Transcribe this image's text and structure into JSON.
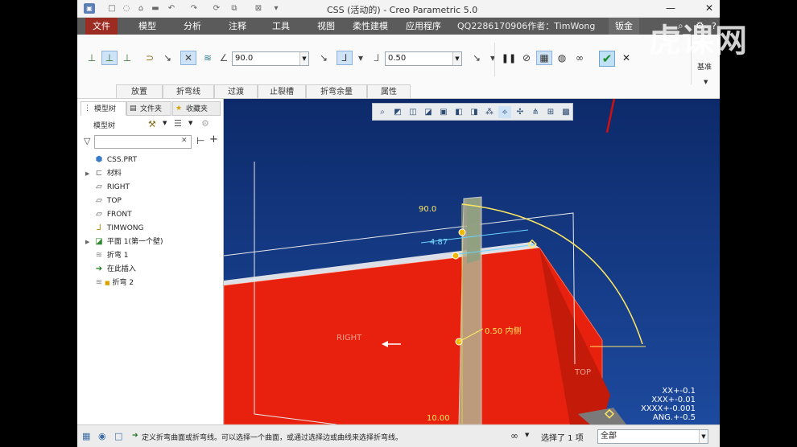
{
  "window": {
    "title": "CSS (活动的) - Creo Parametric 5.0",
    "minimize": "—",
    "close": "✕"
  },
  "menubar": {
    "items": [
      "文件",
      "模型",
      "分析",
      "注释",
      "工具",
      "视图",
      "柔性建模",
      "应用程序"
    ],
    "author": "QQ2286170906作者：TimWong",
    "last": "钣金"
  },
  "ribbon": {
    "angle_value": "90.0",
    "radius_value": "0.50",
    "tabs": [
      "放置",
      "折弯线",
      "过渡",
      "止裂槽",
      "折弯余量",
      "属性"
    ],
    "datum_label": "基准"
  },
  "sidebar": {
    "tabs": [
      "模型树",
      "文件夹",
      "收藏夹"
    ],
    "header": "模型树",
    "search_placeholder": "",
    "tree": [
      {
        "label": "CSS.PRT",
        "icon": "part-icon"
      },
      {
        "label": "材料",
        "icon": "material-icon"
      },
      {
        "label": "RIGHT",
        "icon": "plane-icon"
      },
      {
        "label": "TOP",
        "icon": "plane-icon"
      },
      {
        "label": "FRONT",
        "icon": "plane-icon"
      },
      {
        "label": "TIMWONG",
        "icon": "csys-icon"
      },
      {
        "label": "平面 1(第一个壁)",
        "icon": "wall-icon"
      },
      {
        "label": "折弯 1",
        "icon": "bend-icon"
      },
      {
        "label": "在此插入",
        "icon": "insert-arrow-icon"
      },
      {
        "label": "折弯 2",
        "icon": "bend-icon"
      }
    ]
  },
  "viewport": {
    "annotations": {
      "angle": "90.0",
      "offset": "4.87",
      "radius": "0.50 内侧",
      "length": "10.00",
      "right_plane": "RIGHT",
      "top_plane": "TOP"
    },
    "tolerances": [
      "XX+-0.1",
      "XXX+-0.01",
      "XXXX+-0.001",
      "ANG.+-0.5"
    ]
  },
  "statusbar": {
    "message": "定义折弯曲面或折弯线。可以选择一个曲面，或通过选择边或曲线来选择折弯线。",
    "selected": "选择了 1 项",
    "filter": "全部"
  },
  "watermark": "虎课网",
  "colors": {
    "accent": "#9c2b22",
    "surface": "#e8200e",
    "dimension": "#ffe860",
    "arrow": "#d01010"
  }
}
